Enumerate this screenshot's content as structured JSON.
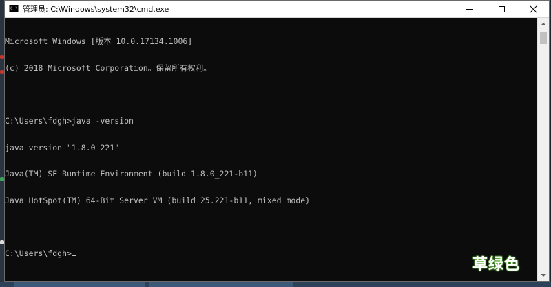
{
  "window": {
    "title": "管理员: C:\\Windows\\system32\\cmd.exe",
    "controls": {
      "minimize": "minimize",
      "maximize": "maximize",
      "close": "close"
    }
  },
  "console": {
    "lines": [
      "Microsoft Windows [版本 10.0.17134.1006]",
      "(c) 2018 Microsoft Corporation。保留所有权利。",
      "",
      "C:\\Users\\fdgh>java -version",
      "java version \"1.8.0_221\"",
      "Java(TM) SE Runtime Environment (build 1.8.0_221-b11)",
      "Java HotSpot(TM) 64-Bit Server VM (build 25.221-b11, mixed mode)",
      "",
      "C:\\Users\\fdgh>"
    ]
  },
  "watermark": {
    "text": "草绿色"
  },
  "colors": {
    "console_bg": "#0c0c0c",
    "console_fg": "#c0c0c0",
    "titlebar_bg": "#ffffff",
    "watermark_glow": "#66c040"
  }
}
